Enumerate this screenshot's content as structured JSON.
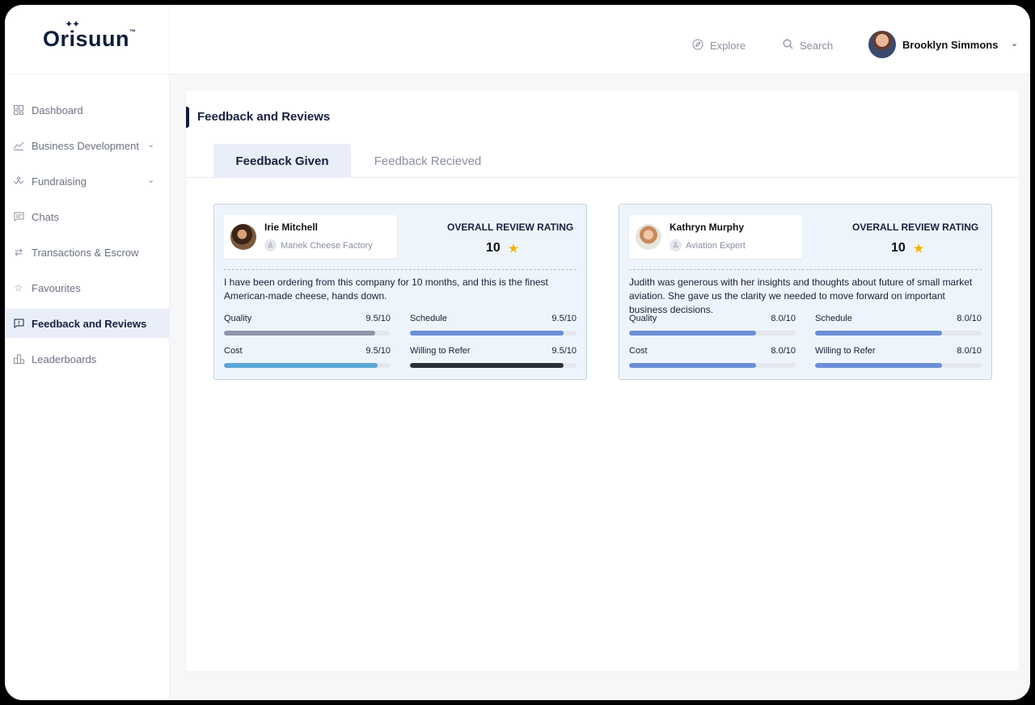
{
  "brand": {
    "name": "Orisuun",
    "tm": "™"
  },
  "sidebar": {
    "items": [
      {
        "label": "Dashboard",
        "icon": "dashboard-icon",
        "active": false,
        "expandable": false
      },
      {
        "label": "Business Development",
        "icon": "chart-icon",
        "active": false,
        "expandable": true
      },
      {
        "label": "Fundraising",
        "icon": "fundraising-icon",
        "active": false,
        "expandable": true
      },
      {
        "label": "Chats",
        "icon": "chat-icon",
        "active": false,
        "expandable": false
      },
      {
        "label": "Transactions & Escrow",
        "icon": "arrows-icon",
        "active": false,
        "expandable": false
      },
      {
        "label": "Favourites",
        "icon": "star-icon",
        "active": false,
        "expandable": false
      },
      {
        "label": "Feedback and Reviews",
        "icon": "feedback-icon",
        "active": true,
        "expandable": false
      },
      {
        "label": "Leaderboards",
        "icon": "leaderboard-icon",
        "active": false,
        "expandable": false
      }
    ]
  },
  "header": {
    "explore_label": "Explore",
    "search_label": "Search",
    "user_name": "Brooklyn Simmons"
  },
  "main": {
    "title": "Feedback and Reviews",
    "tabs": [
      {
        "label": "Feedback Given",
        "active": true
      },
      {
        "label": "Feedback Recieved",
        "active": false
      }
    ],
    "overall_label": "OVERALL REVIEW RATING",
    "cards": [
      {
        "name": "Irie Mitchell",
        "company": "Manek Cheese Factory",
        "rating": "10",
        "comment": "I have been ordering from this company for 10 months, and this is the finest American-made cheese, hands down.",
        "metrics": [
          {
            "label": "Quality",
            "value": "9.5/10",
            "fraction": 0.91,
            "color": "#8e97a8"
          },
          {
            "label": "Schedule",
            "value": "9.5/10",
            "fraction": 0.92,
            "color": "#6b8ed6"
          },
          {
            "label": "Cost",
            "value": "9.5/10",
            "fraction": 0.92,
            "color": "#5aa6d6"
          },
          {
            "label": "Willing to Refer",
            "value": "9.5/10",
            "fraction": 0.92,
            "color": "#2b2f36"
          }
        ]
      },
      {
        "name": "Kathryn Murphy",
        "company": "Aviation Expert",
        "rating": "10",
        "comment": "Judith was generous with her insights and thoughts about future of small market aviation. She gave us the clarity we needed to move forward on important business decisions.",
        "metrics": [
          {
            "label": "Quality",
            "value": "8.0/10",
            "fraction": 0.76,
            "color": "#6b8ed6"
          },
          {
            "label": "Schedule",
            "value": "8.0/10",
            "fraction": 0.76,
            "color": "#6b8ed6"
          },
          {
            "label": "Cost",
            "value": "8.0/10",
            "fraction": 0.76,
            "color": "#6b8ed6"
          },
          {
            "label": "Willing to Refer",
            "value": "8.0/10",
            "fraction": 0.76,
            "color": "#6b8ed6"
          }
        ]
      }
    ]
  }
}
